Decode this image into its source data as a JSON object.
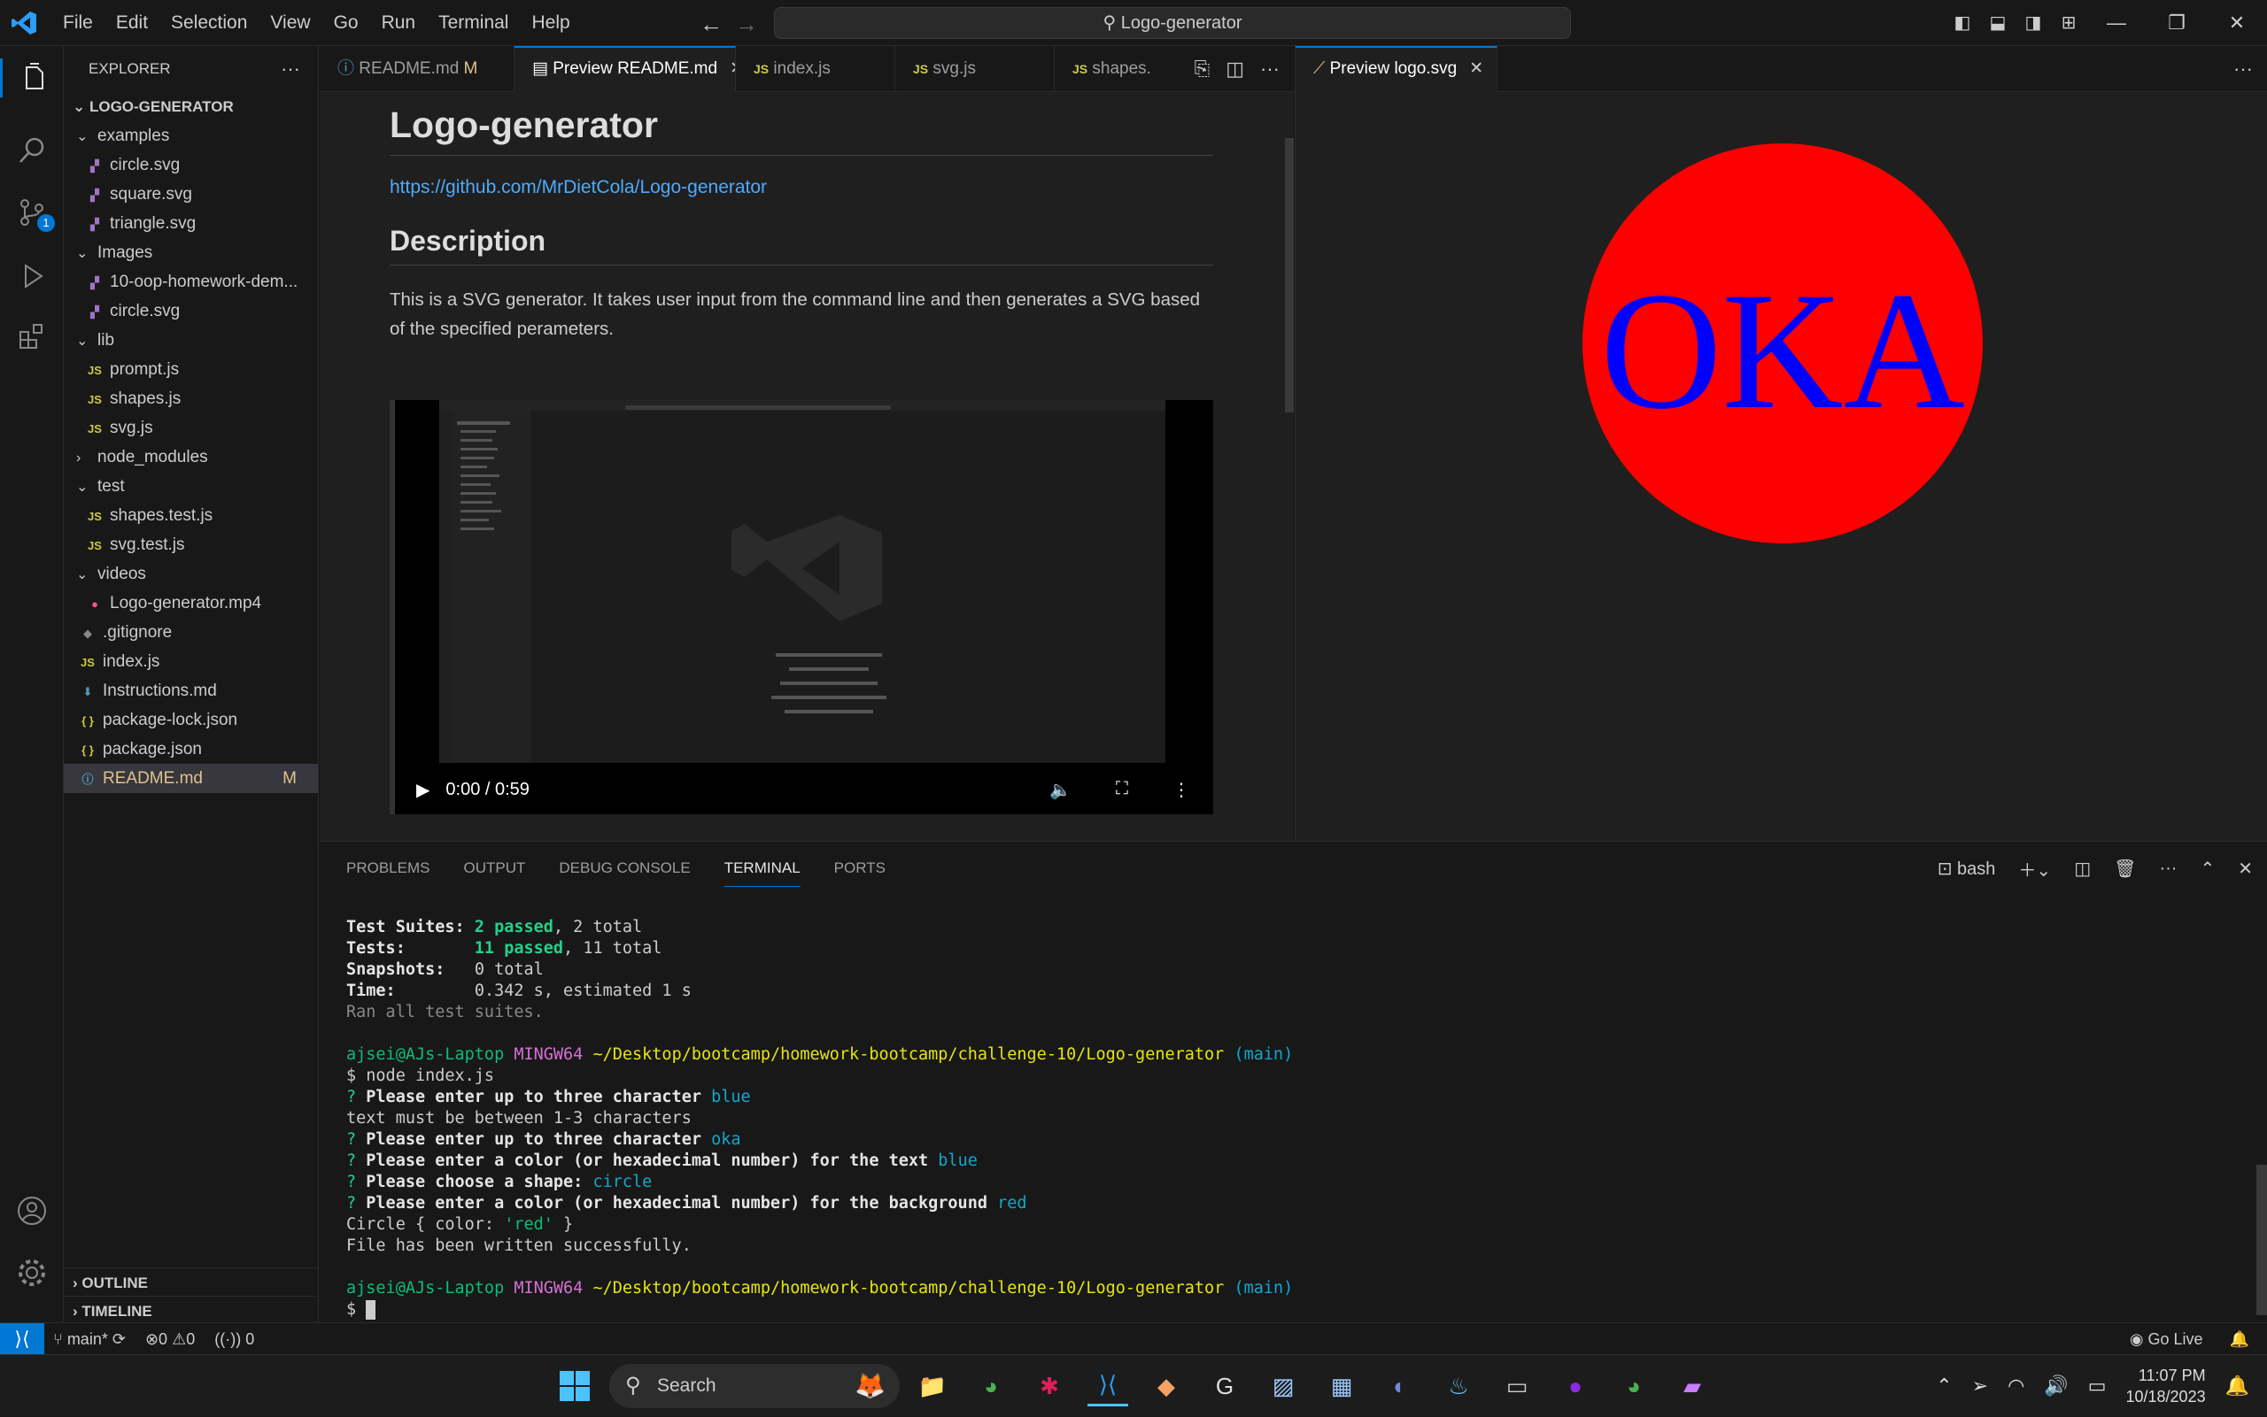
{
  "title_bar": {
    "menu": [
      "File",
      "Edit",
      "Selection",
      "View",
      "Go",
      "Run",
      "Terminal",
      "Help"
    ],
    "search": "Logo-generator"
  },
  "explorer": {
    "header": "EXPLORER",
    "root": "LOGO-GENERATOR",
    "items": [
      {
        "label": "examples",
        "type": "folder",
        "depth": 1
      },
      {
        "label": "circle.svg",
        "type": "svg",
        "depth": 2
      },
      {
        "label": "square.svg",
        "type": "svg",
        "depth": 2
      },
      {
        "label": "triangle.svg",
        "type": "svg",
        "depth": 2
      },
      {
        "label": "Images",
        "type": "folder",
        "depth": 1
      },
      {
        "label": "10-oop-homework-dem...",
        "type": "svg",
        "depth": 2
      },
      {
        "label": "circle.svg",
        "type": "svg",
        "depth": 2
      },
      {
        "label": "lib",
        "type": "folder",
        "depth": 1
      },
      {
        "label": "prompt.js",
        "type": "js",
        "depth": 2
      },
      {
        "label": "shapes.js",
        "type": "js",
        "depth": 2
      },
      {
        "label": "svg.js",
        "type": "js",
        "depth": 2
      },
      {
        "label": "node_modules",
        "type": "folder-closed",
        "depth": 1
      },
      {
        "label": "test",
        "type": "folder",
        "depth": 1
      },
      {
        "label": "shapes.test.js",
        "type": "js",
        "depth": 2
      },
      {
        "label": "svg.test.js",
        "type": "js",
        "depth": 2
      },
      {
        "label": "videos",
        "type": "folder",
        "depth": 1
      },
      {
        "label": "Logo-generator.mp4",
        "type": "mp4",
        "depth": 2
      },
      {
        "label": ".gitignore",
        "type": "git",
        "depth": 1
      },
      {
        "label": "index.js",
        "type": "js",
        "depth": 1
      },
      {
        "label": "Instructions.md",
        "type": "md",
        "depth": 1
      },
      {
        "label": "package-lock.json",
        "type": "json",
        "depth": 1
      },
      {
        "label": "package.json",
        "type": "json",
        "depth": 1
      },
      {
        "label": "README.md",
        "type": "info",
        "depth": 1,
        "selected": true,
        "badge": "M"
      }
    ],
    "outline": "OUTLINE",
    "timeline": "TIMELINE"
  },
  "scm_badge": "1",
  "editor1": {
    "tabs": [
      {
        "label": "README.md",
        "suffix": "M",
        "icon": "ⓘ"
      },
      {
        "label": "Preview README.md",
        "active": true,
        "icon": "▤"
      },
      {
        "label": "index.js",
        "icon": "JS"
      },
      {
        "label": "svg.js",
        "icon": "JS"
      },
      {
        "label": "shapes.",
        "icon": "JS"
      }
    ],
    "preview": {
      "h1": "Logo-generator",
      "link": "https://github.com/MrDietCola/Logo-generator",
      "h2": "Description",
      "para": "This is a SVG generator. It takes user input from the command line and then generates a SVG based of the specified perameters.",
      "video_time": "0:00 / 0:59"
    }
  },
  "editor2": {
    "tab": "Preview logo.svg",
    "svg": {
      "text": "OKA",
      "text_color": "#0000ff",
      "bg_color": "#ff0000"
    }
  },
  "panel": {
    "tabs": [
      "PROBLEMS",
      "OUTPUT",
      "DEBUG CONSOLE",
      "TERMINAL",
      "PORTS"
    ],
    "shell": "bash",
    "terminal": {
      "suites_label": "Test Suites:",
      "suites_pass": "2 passed",
      "suites_total": ", 2 total",
      "tests_label": "Tests:",
      "tests_pass": "11 passed",
      "tests_total": ", 11 total",
      "snap_label": "Snapshots:",
      "snap_val": "0 total",
      "time_label": "Time:",
      "time_val": "0.342 s, estimated 1 s",
      "ran": "Ran all test suites.",
      "user": "ajsei@AJs-Laptop",
      "env": "MINGW64",
      "path": "~/Desktop/bootcamp/homework-bootcamp/challenge-10/Logo-generator",
      "branch": "(main)",
      "cmd": "$ node index.js",
      "q1": "Please enter up to three character",
      "a1": "blue",
      "err": "text must be between 1-3 characters",
      "q2": "Please enter up to three character",
      "a2": "oka",
      "q3": "Please enter a color (or hexadecimal number) for the text",
      "a3": "blue",
      "q4": "Please choose a shape:",
      "a4": "circle",
      "q5": "Please enter a color (or hexadecimal number) for the background",
      "a5": "red",
      "circle_pre": "Circle { color: ",
      "circle_val": "'red'",
      "circle_post": " }",
      "written": "File has been written successfully.",
      "prompt": "$"
    }
  },
  "status": {
    "branch": "main*",
    "errors": "0",
    "warnings": "0",
    "ports": "0",
    "golive": "Go Live"
  },
  "taskbar": {
    "search": "Search",
    "time": "11:07 PM",
    "date": "10/18/2023"
  }
}
